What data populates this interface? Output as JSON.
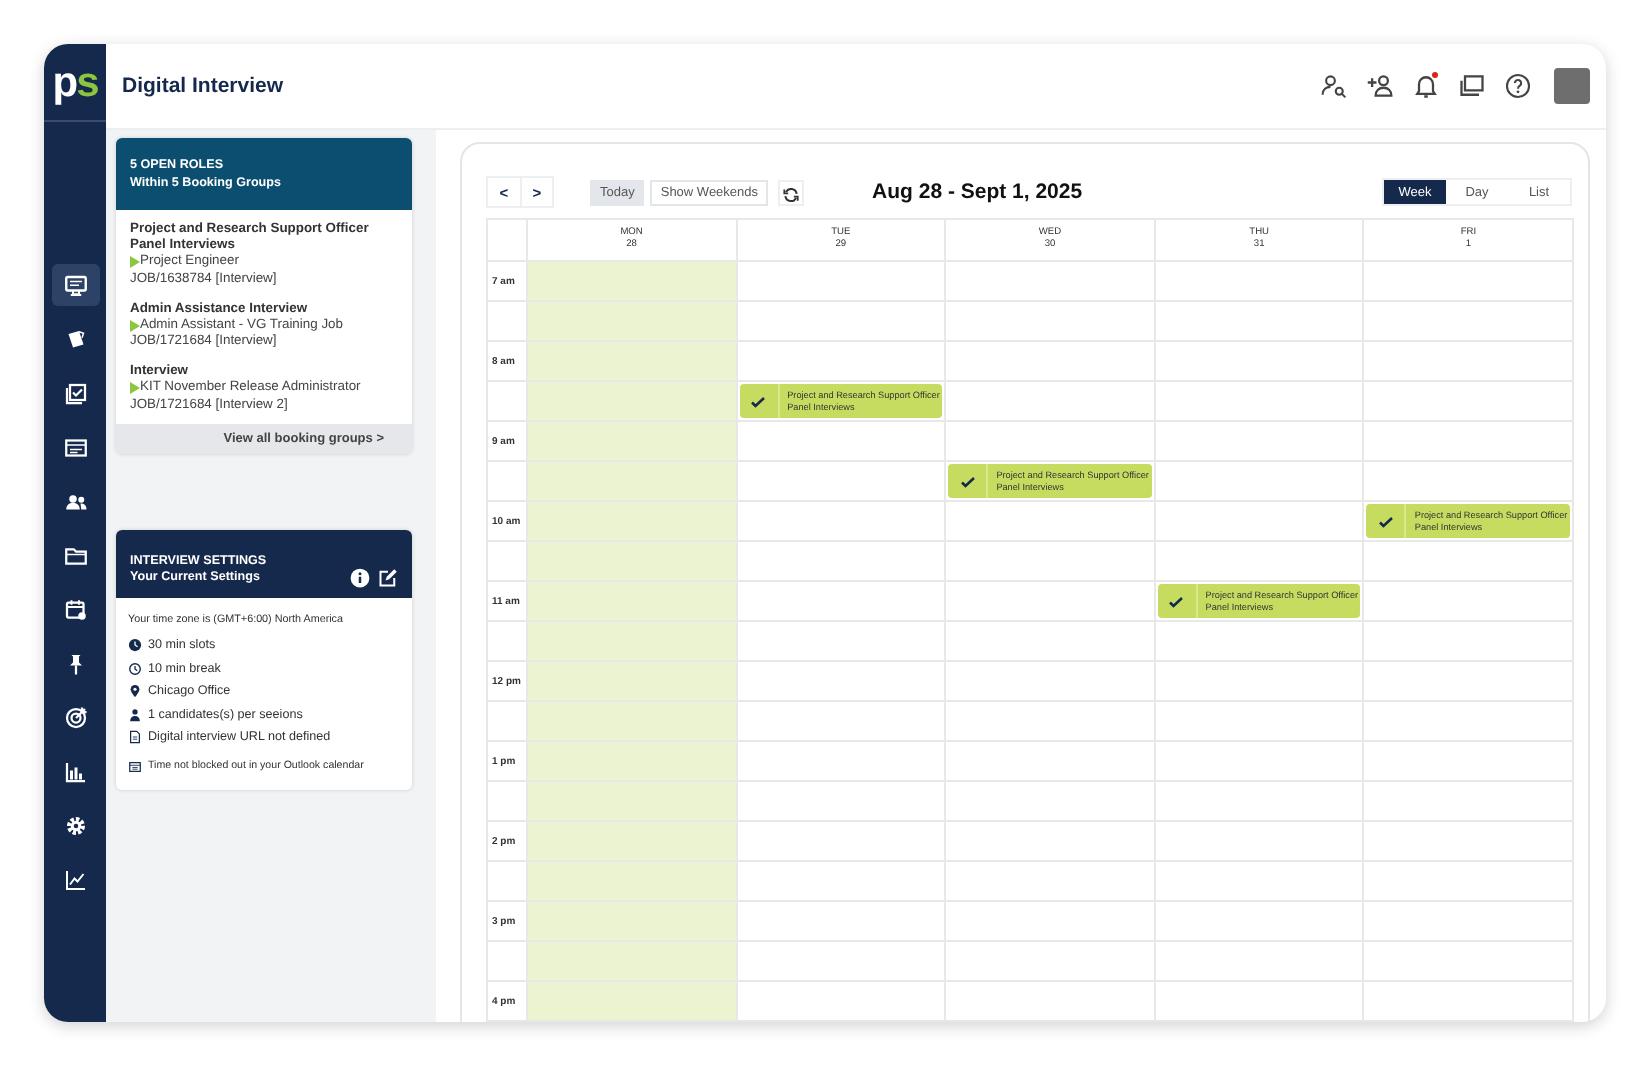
{
  "logo": "ps",
  "header": {
    "title": "Digital Interview",
    "notifications_unread": true,
    "icons": [
      {
        "kind": "user-search"
      },
      {
        "kind": "user-add"
      },
      {
        "kind": "bell"
      },
      {
        "kind": "windows"
      },
      {
        "kind": "help"
      }
    ]
  },
  "sidebar": {
    "items": [
      {
        "kind": "monitor",
        "selected": true
      },
      {
        "kind": "cards",
        "selected": false
      },
      {
        "kind": "checklist",
        "selected": false
      },
      {
        "kind": "idcard",
        "selected": false
      },
      {
        "kind": "people",
        "selected": false
      },
      {
        "kind": "folder",
        "selected": false
      },
      {
        "kind": "calendar",
        "selected": false
      },
      {
        "kind": "pin",
        "selected": false
      },
      {
        "kind": "target",
        "selected": false
      },
      {
        "kind": "bars",
        "selected": false
      },
      {
        "kind": "gear",
        "selected": false
      },
      {
        "kind": "linechart",
        "selected": false
      }
    ]
  },
  "roles_card": {
    "title": "5 OPEN ROLES",
    "subtitle": "Within 5 Booking Groups",
    "groups": [
      {
        "name": "Project and Research Support Officer Panel Interviews",
        "role": "Project Engineer",
        "job": "JOB/1638784 [Interview]"
      },
      {
        "name": "Admin Assistance Interview",
        "role": "Admin Assistant - VG Training Job",
        "job": "JOB/1721684 [Interview]"
      },
      {
        "name": "Interview",
        "role": " KIT November Release Administrator",
        "job": "JOB/1721684 [Interview 2]"
      }
    ],
    "footer_link": "View all booking groups >"
  },
  "settings_card": {
    "title": "INTERVIEW SETTINGS",
    "subtitle": "Your Current Settings",
    "timezone": "Your time zone is (GMT+6:00) North America",
    "items": [
      {
        "kind": "clock-filled",
        "text": "30 min slots"
      },
      {
        "kind": "clock",
        "text": "10 min break"
      },
      {
        "kind": "location",
        "text": "Chicago Office"
      },
      {
        "kind": "person",
        "text": "1 candidates(s) per seeions"
      },
      {
        "kind": "document",
        "text": "Digital interview URL not defined"
      },
      {
        "kind": "calendar",
        "text": "Time not blocked out in your Outlook calendar"
      }
    ]
  },
  "calendar": {
    "prev": "<",
    "next": ">",
    "today": "Today",
    "show_weekends": "Show Weekends",
    "range": "Aug 28 - Sept 1, 2025",
    "views": [
      {
        "label": "Week",
        "selected": true
      },
      {
        "label": "Day",
        "selected": false
      },
      {
        "label": "List",
        "selected": false
      }
    ],
    "days": [
      {
        "weekday": "MON",
        "date": "28",
        "today": true
      },
      {
        "weekday": "TUE",
        "date": "29",
        "today": false
      },
      {
        "weekday": "WED",
        "date": "30",
        "today": false
      },
      {
        "weekday": "THU",
        "date": "31",
        "today": false
      },
      {
        "weekday": "FRI",
        "date": "1",
        "today": false
      }
    ],
    "hours": [
      {
        "label": "7 am"
      },
      {
        "label": "8 am",
        "second_half": [
          {
            "booked": false
          },
          {
            "booked": true,
            "title": "Project and Research Support Officer Panel Interviews",
            "confirmed": true
          },
          {
            "booked": false
          },
          {
            "booked": false
          },
          {
            "booked": false
          }
        ]
      },
      {
        "label": "9 am",
        "second_half": [
          {
            "booked": false
          },
          {
            "booked": false
          },
          {
            "booked": true,
            "title": "Project and Research Support Officer Panel Interviews",
            "confirmed": true
          },
          {
            "booked": false
          },
          {
            "booked": false
          }
        ]
      },
      {
        "label": "10 am",
        "first_half": [
          {
            "booked": false
          },
          {
            "booked": false
          },
          {
            "booked": false
          },
          {
            "booked": false
          },
          {
            "booked": true,
            "title": "Project and Research Support Officer Panel Interviews",
            "confirmed": true
          }
        ]
      },
      {
        "label": "11 am",
        "first_half": [
          {
            "booked": false
          },
          {
            "booked": false
          },
          {
            "booked": false
          },
          {
            "booked": true,
            "title": "Project and Research Support Officer Panel Interviews",
            "confirmed": true
          },
          {
            "booked": false
          }
        ]
      },
      {
        "label": "12 pm"
      },
      {
        "label": "1 pm"
      },
      {
        "label": "2 pm"
      },
      {
        "label": "3 pm"
      },
      {
        "label": "4 pm"
      }
    ]
  }
}
